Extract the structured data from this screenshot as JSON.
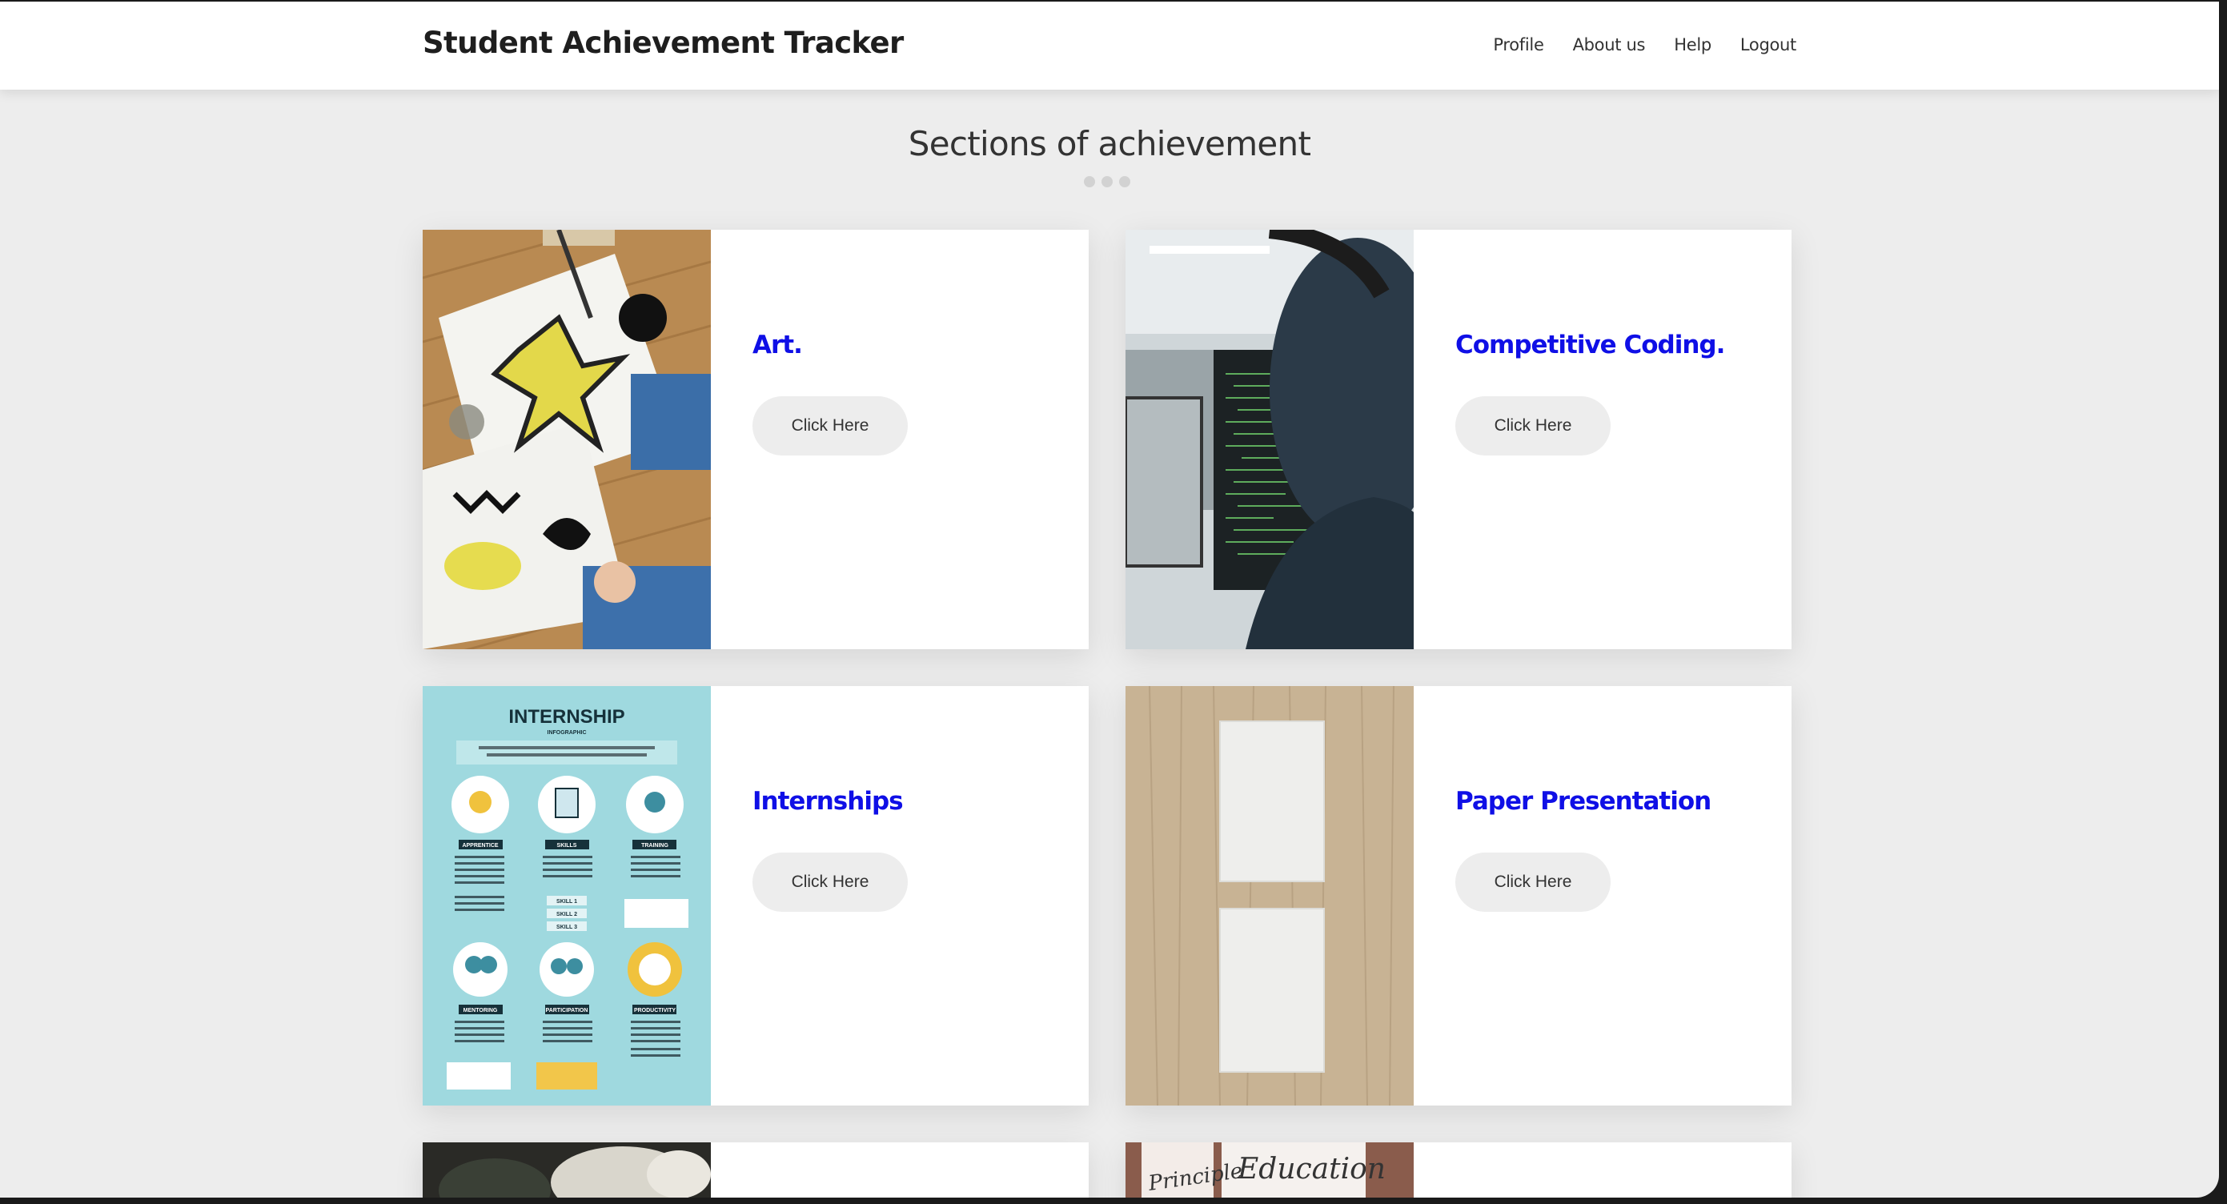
{
  "app": {
    "brand": "Student Achievement Tracker"
  },
  "nav": {
    "items": [
      "Profile",
      "About us",
      "Help",
      "Logout"
    ]
  },
  "main": {
    "heading": "Sections of achievement",
    "cards": [
      {
        "title": "Art.",
        "button": "Click Here"
      },
      {
        "title": "Competitive Coding.",
        "button": "Click Here"
      },
      {
        "title": "Internships",
        "button": "Click Here"
      },
      {
        "title": "Paper Presentation",
        "button": "Click Here"
      }
    ],
    "infographic": {
      "title": "INTERNSHIP",
      "subtitle": "INFOGRAPHIC",
      "labels": [
        "APPRENTICE",
        "SKILLS",
        "TRAINING",
        "MENTORING",
        "PARTICIPATION",
        "PRODUCTIVITY"
      ],
      "skills": [
        "SKILL 1",
        "SKILL 2",
        "SKILL 3"
      ]
    },
    "partial_image_text": {
      "left": "Principle",
      "right": "Education"
    }
  },
  "colors": {
    "accent": "#0f0fe6",
    "page_bg": "#ededed",
    "card_bg": "#ffffff",
    "button_bg": "#ededed"
  },
  "icons": [
    "art-photo",
    "coding-photo",
    "internship-infographic",
    "paper-photo"
  ]
}
